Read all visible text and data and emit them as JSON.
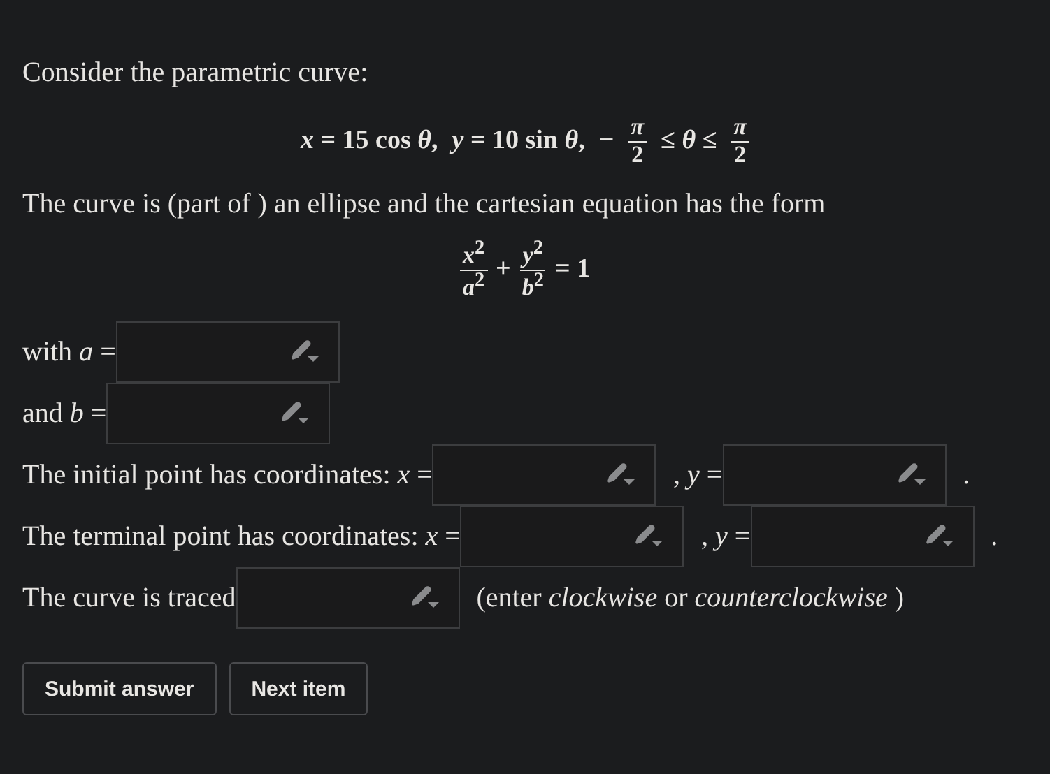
{
  "intro": "Consider the parametric curve:",
  "parametric": [
    {
      "kind": "text",
      "text": "*x* = 15 cos *θ*,"
    },
    {
      "kind": "text",
      "text": "*y* = 10 sin *θ*,"
    },
    {
      "kind": "text",
      "text": "−"
    },
    {
      "kind": "frac",
      "num": "*π*",
      "den": "2"
    },
    {
      "kind": "text",
      "text": "≤ *θ* ≤"
    },
    {
      "kind": "frac",
      "num": "*π*",
      "den": "2"
    }
  ],
  "statement": "The curve is (part of ) an ellipse and the cartesian equation has the form",
  "cartesian": [
    {
      "kind": "frac",
      "num": "*x*$^{2}$",
      "den": "*a*$^{2}$"
    },
    {
      "kind": "text",
      "text": "+"
    },
    {
      "kind": "frac",
      "num": "*y*$^{2}$",
      "den": "*b*$^{2}$"
    },
    {
      "kind": "text",
      "text": "= 1"
    }
  ],
  "answer_lines": [
    {
      "items": [
        {
          "kind": "text",
          "text": "with *a* ="
        },
        {
          "kind": "field"
        }
      ]
    },
    {
      "items": [
        {
          "kind": "text",
          "text": "and *b* ="
        },
        {
          "kind": "field"
        }
      ]
    },
    {
      "items": [
        {
          "kind": "text",
          "text": "The initial point has coordinates: *x* ="
        },
        {
          "kind": "field"
        },
        {
          "kind": "text",
          "text": ", *y* ="
        },
        {
          "kind": "field"
        },
        {
          "kind": "text",
          "text": "."
        }
      ]
    },
    {
      "items": [
        {
          "kind": "text",
          "text": "The terminal point has coordinates: *x* ="
        },
        {
          "kind": "field"
        },
        {
          "kind": "text",
          "text": ", *y* ="
        },
        {
          "kind": "field"
        },
        {
          "kind": "text",
          "text": "."
        }
      ]
    },
    {
      "items": [
        {
          "kind": "text",
          "text": "The curve is traced"
        },
        {
          "kind": "field"
        },
        {
          "kind": "text",
          "text": "(enter *clockwise* or *counterclockwise* )"
        }
      ]
    }
  ],
  "buttons": [
    "Submit answer",
    "Next item"
  ]
}
